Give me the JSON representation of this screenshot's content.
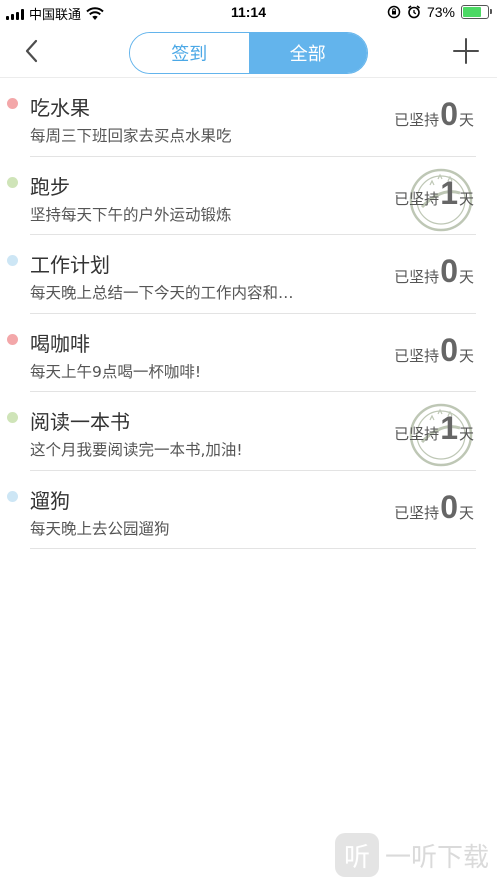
{
  "status_bar": {
    "carrier": "中国联通",
    "time": "11:14",
    "battery_percent": "73%",
    "battery_level": 0.73,
    "icons": [
      "signal-icon",
      "wifi-icon",
      "orientation-lock-icon",
      "alarm-icon",
      "battery-icon"
    ]
  },
  "nav": {
    "back_icon": "chevron-left-icon",
    "add_icon": "plus-icon",
    "tabs": [
      {
        "label": "签到",
        "active": false
      },
      {
        "label": "全部",
        "active": true
      }
    ]
  },
  "streak_prefix": "已坚持",
  "streak_suffix": "天",
  "habits": [
    {
      "title": "吃水果",
      "desc": "每周三下班回家去买点水果吃",
      "days": "0",
      "dot_color": "#f3a7a9",
      "stamped": false
    },
    {
      "title": "跑步",
      "desc": "坚持每天下午的户外运动锻炼",
      "days": "1",
      "dot_color": "#cfe4b8",
      "stamped": true
    },
    {
      "title": "工作计划",
      "desc": "每天晚上总结一下今天的工作内容和…",
      "days": "0",
      "dot_color": "#cde6f5",
      "stamped": false
    },
    {
      "title": "喝咖啡",
      "desc": "每天上午9点喝一杯咖啡!",
      "days": "0",
      "dot_color": "#f3a7a9",
      "stamped": false
    },
    {
      "title": "阅读一本书",
      "desc": "这个月我要阅读完一本书,加油!",
      "days": "1",
      "dot_color": "#cfe4b8",
      "stamped": true
    },
    {
      "title": "遛狗",
      "desc": "每天晚上去公园遛狗",
      "days": "0",
      "dot_color": "#cde6f5",
      "stamped": false
    }
  ],
  "watermark": {
    "logo_text": "听",
    "text": "一听下载"
  }
}
